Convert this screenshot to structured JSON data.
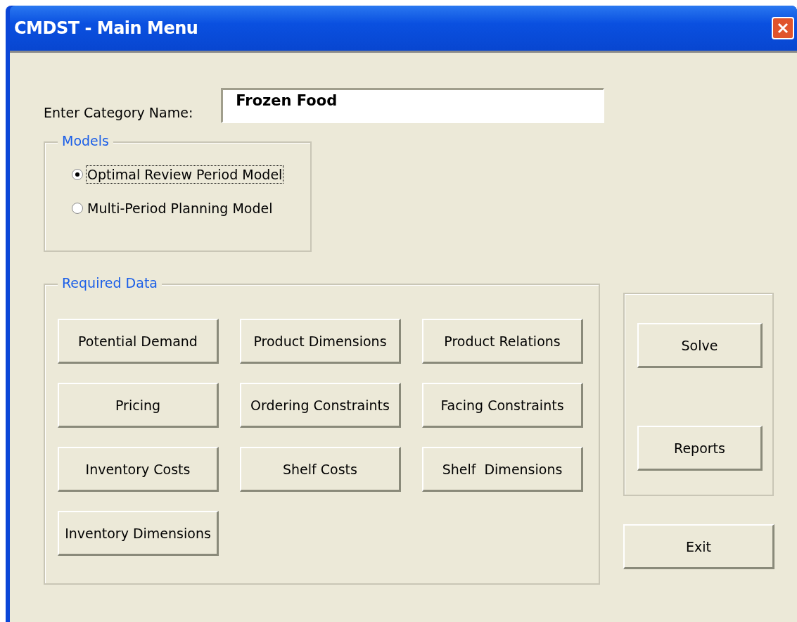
{
  "window": {
    "title": "CMDST - Main Menu"
  },
  "category": {
    "label": "Enter Category Name:",
    "value": "Frozen Food"
  },
  "models": {
    "legend": "Models",
    "options": [
      {
        "label": "Optimal Review Period Model",
        "selected": true
      },
      {
        "label": "Multi-Period Planning Model",
        "selected": false
      }
    ]
  },
  "required_data": {
    "legend": "Required Data",
    "buttons": [
      "Potential Demand",
      "Product Dimensions",
      "Product Relations",
      "Pricing",
      "Ordering Constraints",
      "Facing Constraints",
      "Inventory Costs",
      "Shelf Costs",
      "Shelf  Dimensions",
      "Inventory Dimensions"
    ]
  },
  "actions": [
    "Solve",
    "Reports"
  ],
  "exit": "Exit"
}
